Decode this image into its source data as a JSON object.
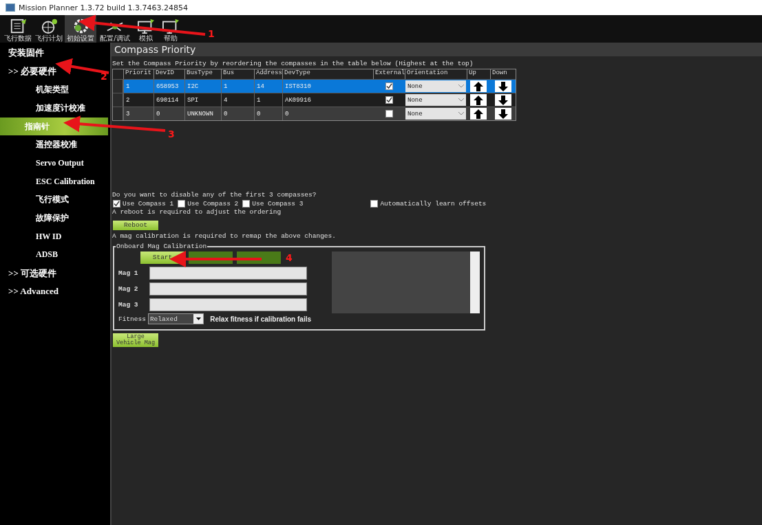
{
  "window": {
    "title": "Mission Planner 1.3.72 build 1.3.7463.24854"
  },
  "toolbar": [
    {
      "label": "飞行数据",
      "selected": false
    },
    {
      "label": "飞行计划",
      "selected": false
    },
    {
      "label": "初始设置",
      "selected": true
    },
    {
      "label": "配置/调试",
      "selected": false
    },
    {
      "label": "模拟",
      "selected": false
    },
    {
      "label": "帮助",
      "selected": false
    }
  ],
  "sidebar": {
    "items": [
      {
        "label": "安装固件",
        "selected": false
      },
      {
        "label": ">> 必要硬件",
        "selected": false,
        "children": [
          {
            "label": "机架类型",
            "selected": false
          },
          {
            "label": "加速度计校准",
            "selected": false
          },
          {
            "label": "指南针",
            "selected": true
          },
          {
            "label": "遥控器校准",
            "selected": false
          },
          {
            "label": "Servo Output",
            "selected": false
          },
          {
            "label": "ESC Calibration",
            "selected": false
          },
          {
            "label": "飞行模式",
            "selected": false
          },
          {
            "label": "故障保护",
            "selected": false
          },
          {
            "label": "HW ID",
            "selected": false
          },
          {
            "label": "ADSB",
            "selected": false
          }
        ]
      },
      {
        "label": ">> 可选硬件",
        "selected": false
      },
      {
        "label": ">> Advanced",
        "selected": false
      }
    ]
  },
  "header": "Compass Priority",
  "intro": "Set the Compass Priority by reordering the compasses in the table below (Highest at the top)",
  "table": {
    "columns": [
      "Priorit",
      "DevID",
      "BusType",
      "Bus",
      "Address",
      "DevType",
      "External",
      "Orientation",
      "Up",
      "Down"
    ],
    "rows": [
      {
        "selected": true,
        "cells": [
          "1",
          "658953",
          "I2C",
          "1",
          "14",
          "IST8310"
        ],
        "external": true,
        "orientation": "None"
      },
      {
        "selected": false,
        "cells": [
          "2",
          "690114",
          "SPI",
          "4",
          "1",
          "AK09916"
        ],
        "external": true,
        "orientation": "None"
      },
      {
        "selected": false,
        "cells": [
          "3",
          "0",
          "UNKNOWN",
          "0",
          "0",
          "0"
        ],
        "external": false,
        "orientation": "None"
      }
    ]
  },
  "disable_question": "Do you want to disable any of the first 3 compasses?",
  "use_compass": [
    {
      "label": "Use Compass 1",
      "checked": true
    },
    {
      "label": "Use Compass 2",
      "checked": false
    },
    {
      "label": "Use Compass 3",
      "checked": false
    }
  ],
  "auto_learn": {
    "label": "Automatically learn offsets",
    "checked": false
  },
  "reboot_note": "A reboot is required to adjust the ordering",
  "reboot_button": "Reboot",
  "mag_note": "A mag calibration is required to remap the above changes.",
  "onboard": {
    "title": "Onboard Mag Calibration",
    "start": "Start",
    "mags": [
      "Mag 1",
      "Mag 2",
      "Mag 3"
    ],
    "fitness_label": "Fitness",
    "fitness_value": "Relaxed",
    "relax_note": "Relax fitness if calibration fails"
  },
  "large_vehicle_button": [
    "Large",
    "Vehicle Mag"
  ],
  "annotations": [
    {
      "number": "1"
    },
    {
      "number": "2"
    },
    {
      "number": "3"
    },
    {
      "number": "4"
    }
  ]
}
